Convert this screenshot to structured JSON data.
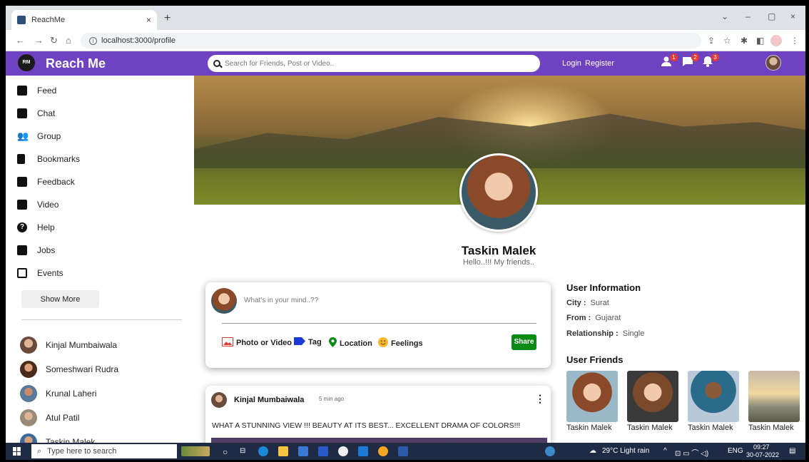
{
  "browser": {
    "tab_title": "ReachMe",
    "tab_close": "×",
    "new_tab": "+",
    "url": "localhost:3000/profile",
    "win_min": "–",
    "win_max": "▢",
    "win_close": "×"
  },
  "header": {
    "logo_text": "RM",
    "app_name": "Reach Me",
    "search_placeholder": "Search for Friends, Post or Video..",
    "login": "Login",
    "register": "Register",
    "badges": {
      "friends": "1",
      "messages": "2",
      "notifications": "3"
    }
  },
  "sidebar": {
    "items": [
      {
        "label": "Feed",
        "icon": "feed-icon"
      },
      {
        "label": "Chat",
        "icon": "chat-icon"
      },
      {
        "label": "Group",
        "icon": "group-icon"
      },
      {
        "label": "Bookmarks",
        "icon": "bookmark-icon"
      },
      {
        "label": "Feedback",
        "icon": "feedback-icon"
      },
      {
        "label": "Video",
        "icon": "video-icon"
      },
      {
        "label": "Help",
        "icon": "help-icon"
      },
      {
        "label": "Jobs",
        "icon": "briefcase-icon"
      },
      {
        "label": "Events",
        "icon": "calendar-icon"
      }
    ],
    "show_more": "Show More",
    "friends": [
      {
        "name": "Kinjal Mumbaiwala"
      },
      {
        "name": "Someshwari Rudra"
      },
      {
        "name": "Krunal Laheri"
      },
      {
        "name": "Atul Patil"
      },
      {
        "name": "Taskin Malek"
      }
    ]
  },
  "profile": {
    "name": "Taskin Malek",
    "bio": "Hello..!!! My friends.."
  },
  "share": {
    "placeholder": "What's in your mind..??",
    "options": [
      "Photo or Video",
      "Tag",
      "Location",
      "Feelings"
    ],
    "button": "Share"
  },
  "post": {
    "user": "Kinjal Mumbaiwala",
    "time": "5 min ago",
    "more": "⋮",
    "text": "WHAT A STUNNING VIEW !!! BEAUTY AT ITS BEST... EXCELLENT DRAMA OF COLORS!!!"
  },
  "user_info": {
    "title": "User Information",
    "rows": [
      {
        "key": "City :",
        "value": "Surat"
      },
      {
        "key": "From :",
        "value": "Gujarat"
      },
      {
        "key": "Relationship :",
        "value": "Single"
      }
    ]
  },
  "user_friends": {
    "title": "User Friends",
    "items": [
      {
        "name": "Taskin Malek"
      },
      {
        "name": "Taskin Malek"
      },
      {
        "name": "Taskin Malek"
      },
      {
        "name": "Taskin Malek"
      }
    ]
  },
  "taskbar": {
    "search_placeholder": "Type here to search",
    "weather": "29°C Light rain",
    "lang": "ENG",
    "time": "09:27",
    "date": "30-07-2022"
  },
  "colors": {
    "brand": "#6f42c1",
    "share_button": "#0a8a16",
    "badge": "#e53935"
  }
}
